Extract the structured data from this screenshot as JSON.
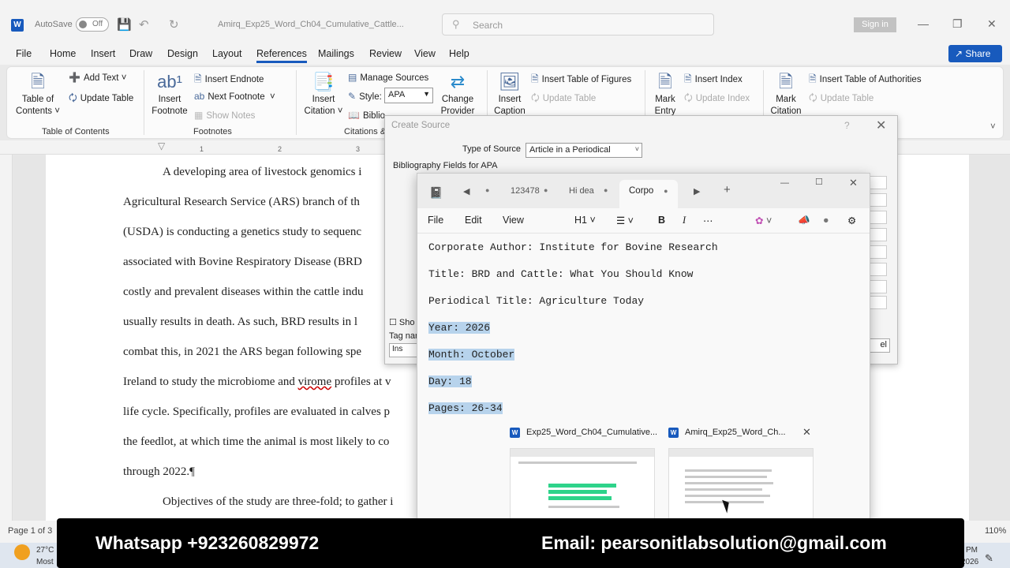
{
  "titlebar": {
    "app_icon": "W",
    "autosave_label": "AutoSave",
    "autosave_state": "Off",
    "doc_title": "Amirq_Exp25_Word_Ch04_Cumulative_Cattle...",
    "search_placeholder": "Search",
    "sign_in": "Sign in"
  },
  "menu": {
    "tabs": [
      "File",
      "Home",
      "Insert",
      "Draw",
      "Design",
      "Layout",
      "References",
      "Mailings",
      "Review",
      "View",
      "Help"
    ],
    "active": "References",
    "share": "Share"
  },
  "ribbon": {
    "toc": {
      "big_label_1": "Table of",
      "big_label_2": "Contents",
      "add_text": "Add Text",
      "update_table": "Update Table",
      "group": "Table of Contents"
    },
    "footnotes": {
      "insert_1": "Insert",
      "insert_2": "Footnote",
      "insert_endnote": "Insert Endnote",
      "next_footnote": "Next Footnote",
      "show_notes": "Show Notes",
      "group": "Footnotes"
    },
    "citations": {
      "insert_1": "Insert",
      "insert_2": "Citation",
      "manage_sources": "Manage Sources",
      "style_label": "Style:",
      "style_value": "APA",
      "bibliography": "Biblio",
      "change_1": "Change",
      "change_2": "Provider",
      "group": "Citations &"
    },
    "captions": {
      "insert_1": "Insert",
      "insert_2": "Caption",
      "insert_tof": "Insert Table of Figures",
      "update_table": "Update Table"
    },
    "index": {
      "mark_1": "Mark",
      "mark_2": "Entry",
      "insert_index": "Insert Index",
      "update_index": "Update Index"
    },
    "authorities": {
      "mark_1": "Mark",
      "mark_2": "Citation",
      "insert_toa": "Insert Table of Authorities",
      "update_table": "Update Table"
    }
  },
  "ruler": {
    "ticks": [
      "1",
      "2",
      "3"
    ]
  },
  "document": {
    "lines": [
      "A developing area of livestock genomics i",
      "Agricultural Research Service (ARS) branch of th",
      "(USDA) is conducting a genetics study to sequenc",
      "associated with Bovine Respiratory Disease (BRD",
      "costly and prevalent diseases within the cattle indu",
      "usually results in death. As such, BRD results in l",
      "combat this, in 2021 the ARS began following spe",
      "Ireland to study the microbiome and virome profiles at v",
      "life cycle. Specifically, profiles are evaluated in calves p",
      "the feedlot, at which time the animal is most likely to co",
      "through 2022.¶",
      "Objectives of the study are three-fold; to gather i"
    ]
  },
  "dialog": {
    "title": "Create Source",
    "help": "?",
    "type_of_source_label": "Type of Source",
    "type_of_source_value": "Article in a Periodical",
    "bibliography_fields": "Bibliography Fields for APA",
    "show_label": "Sho",
    "tag_label": "Tag nar",
    "tag_value": "Ins",
    "cancel": "el"
  },
  "notepad": {
    "tabs": [
      {
        "label": "123478"
      },
      {
        "label": "Hi dea"
      },
      {
        "label": "Corpo"
      }
    ],
    "menu": {
      "file": "File",
      "edit": "Edit",
      "view": "View",
      "heading": "H1"
    },
    "lines": [
      "Corporate Author: Institute for Bovine Research",
      "Title: BRD and Cattle: What You Should Know",
      "Periodical Title: Agriculture Today",
      "Year: 2026",
      "Month: October",
      "Day: 18",
      "Pages: 26-34"
    ],
    "thumb1_title": "Exp25_Word_Ch04_Cumulative...",
    "thumb2_title": "Amirq_Exp25_Word_Ch..."
  },
  "statusbar": {
    "page": "Page 1 of 3",
    "zoom": "110%"
  },
  "banner": {
    "whatsapp": "Whatsapp +923260829972",
    "email": "Email: pearsonitlabsolution@gmail.com"
  },
  "taskbar": {
    "temp": "27°C",
    "weather": "Most",
    "time": "PM",
    "date": "2026"
  }
}
